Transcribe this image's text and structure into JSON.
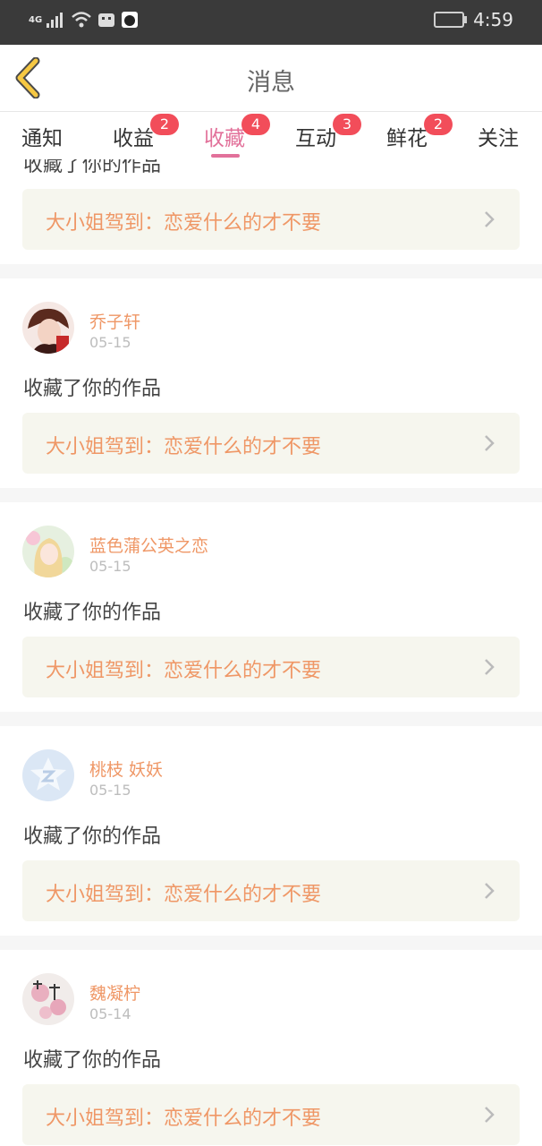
{
  "status_bar": {
    "time": "4:59",
    "network": "4G"
  },
  "header": {
    "title": "消息"
  },
  "tabs": [
    {
      "label": "通知"
    },
    {
      "label": "收益",
      "badge": "2"
    },
    {
      "label": "收藏",
      "badge": "4",
      "active": true
    },
    {
      "label": "互动",
      "badge": "3"
    },
    {
      "label": "鲜花",
      "badge": "2"
    },
    {
      "label": "关注"
    }
  ],
  "partial_item": {
    "action": "收藏了你的作品",
    "work_title": "大小姐驾到：恋爱什么的才不要"
  },
  "items": [
    {
      "name": "乔子轩",
      "date": "05-15",
      "action": "收藏了你的作品",
      "work_title": "大小姐驾到：恋爱什么的才不要",
      "avatar": "anime-boy-avatar"
    },
    {
      "name": "蓝色蒲公英之恋",
      "date": "05-15",
      "action": "收藏了你的作品",
      "work_title": "大小姐驾到：恋爱什么的才不要",
      "avatar": "anime-girl-avatar"
    },
    {
      "name": "桃枝 妖妖",
      "date": "05-15",
      "action": "收藏了你的作品",
      "work_title": "大小姐驾到：恋爱什么的才不要",
      "avatar": "default-qq-avatar"
    },
    {
      "name": "魏凝柠",
      "date": "05-14",
      "action": "收藏了你的作品",
      "work_title": "大小姐驾到：恋爱什么的才不要",
      "avatar": "calligraphy-avatar"
    }
  ],
  "colors": {
    "accent": "#e2719a",
    "badge": "#f24d5a",
    "work_title": "#ef9766",
    "back_arrow": "#f6c843"
  }
}
